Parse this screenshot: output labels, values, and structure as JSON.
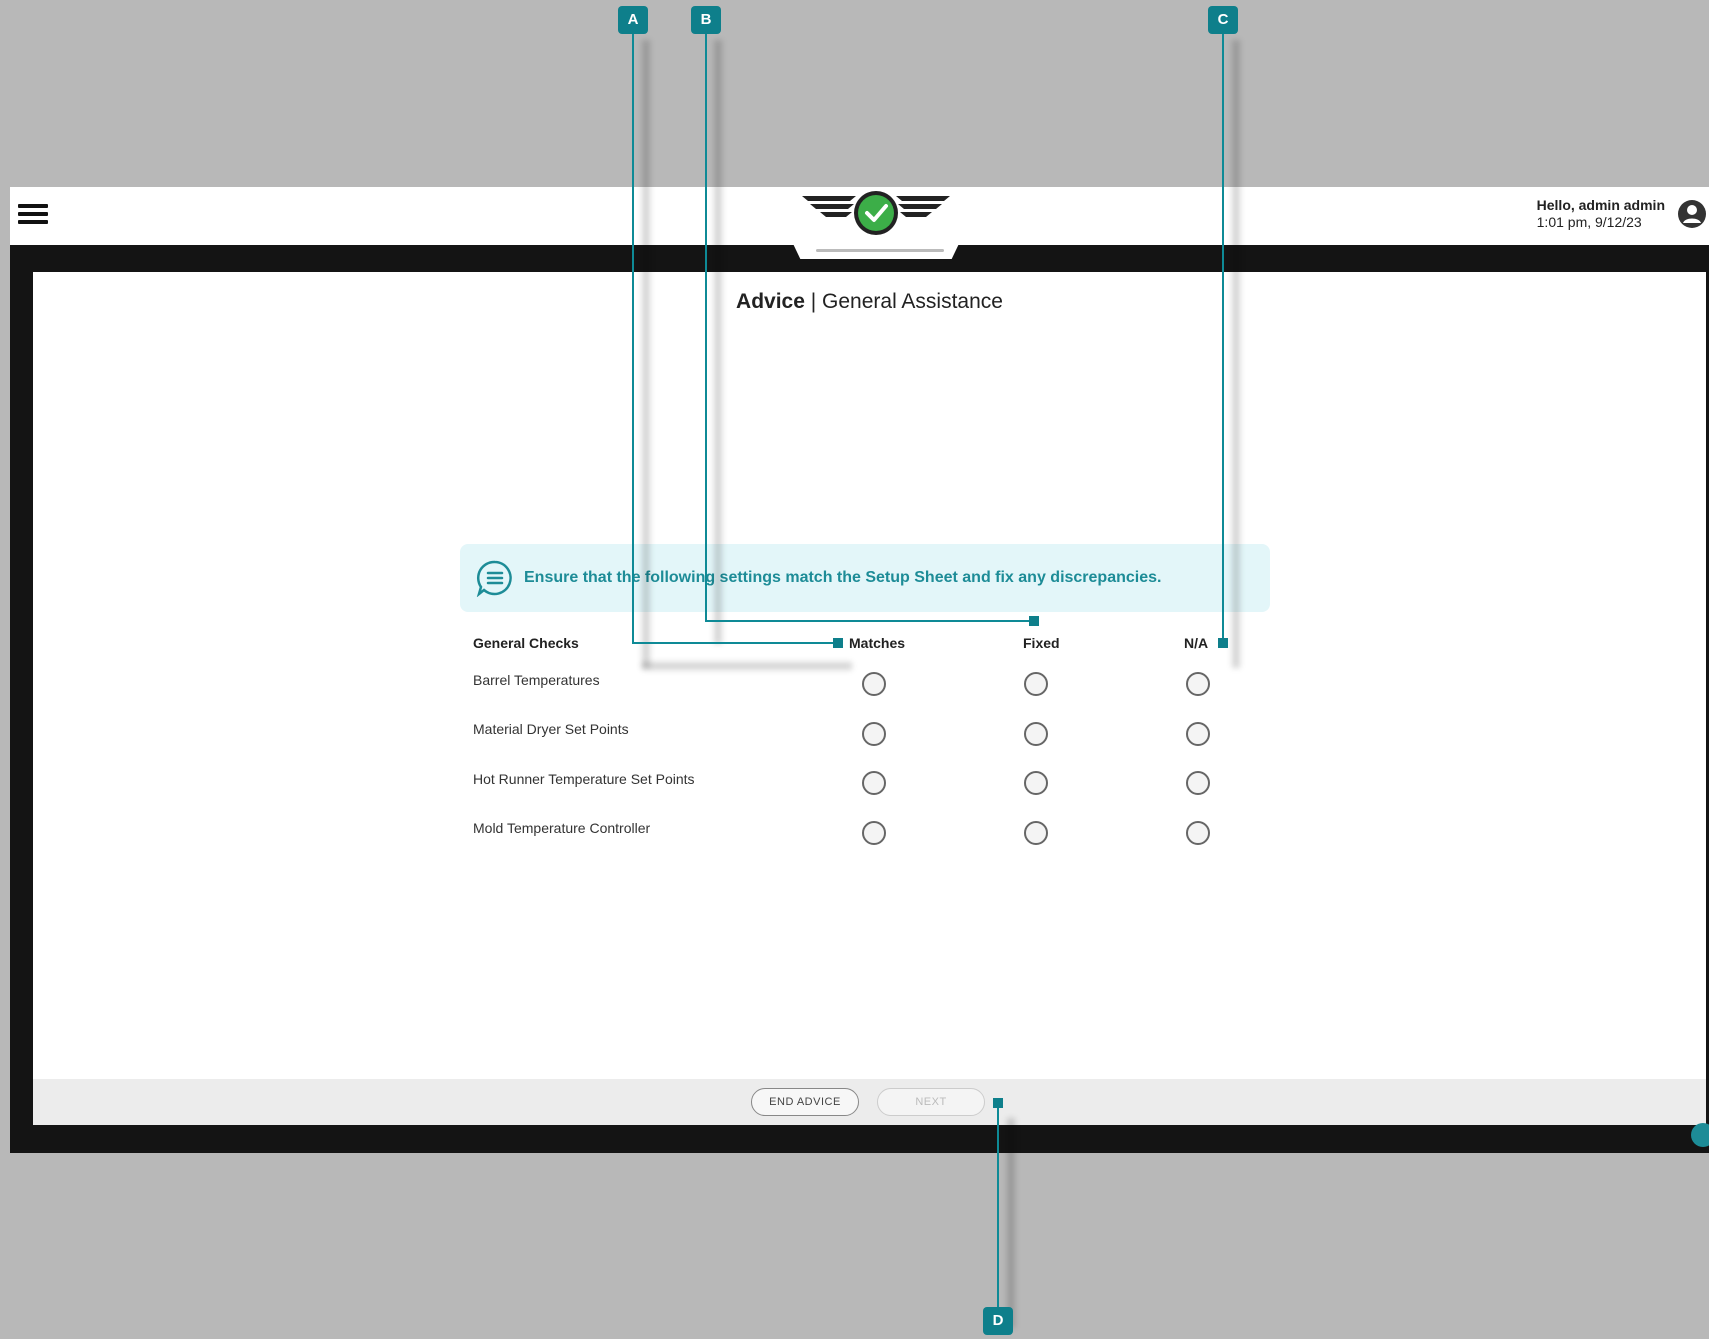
{
  "header": {
    "greeting": "Hello, admin admin",
    "datetime": "1:01 pm, 9/12/23"
  },
  "page": {
    "title_bold": "Advice",
    "title_sep": " | ",
    "title_rest": "General Assistance"
  },
  "banner": {
    "text": "Ensure that the following settings match the Setup Sheet and fix any discrepancies."
  },
  "checks": {
    "headers": [
      "General Checks",
      "Matches",
      "Fixed",
      "N/A"
    ],
    "rows": [
      "Barrel Temperatures",
      "Material Dryer Set Points",
      "Hot Runner Temperature Set Points",
      "Mold Temperature Controller"
    ]
  },
  "footer": {
    "end_label": "END ADVICE",
    "next_label": "NEXT"
  },
  "callouts": [
    "A",
    "B",
    "C",
    "D"
  ],
  "colors": {
    "accent": "#0e7f8b",
    "banner_bg": "#e3f6f9",
    "logo_check": "#3cae48"
  }
}
